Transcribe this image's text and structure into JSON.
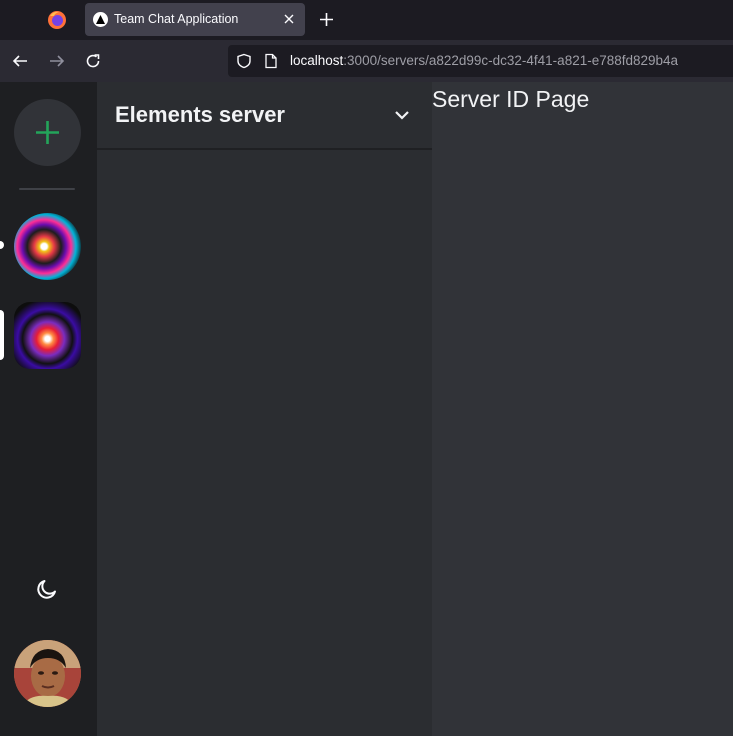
{
  "browser": {
    "tab": {
      "title": "Team Chat Application"
    },
    "url": {
      "host": "localhost",
      "rest": ":3000/servers/a822d99c-dc32-4f41-a821-e788fd829b4a"
    }
  },
  "rail": {
    "icons": [
      "plus-icon",
      "moon-icon"
    ],
    "servers": [
      "server-1",
      "server-2"
    ],
    "accent": "#23a55a"
  },
  "channels": {
    "server_name": "Elements server"
  },
  "main": {
    "title": "Server ID Page"
  }
}
